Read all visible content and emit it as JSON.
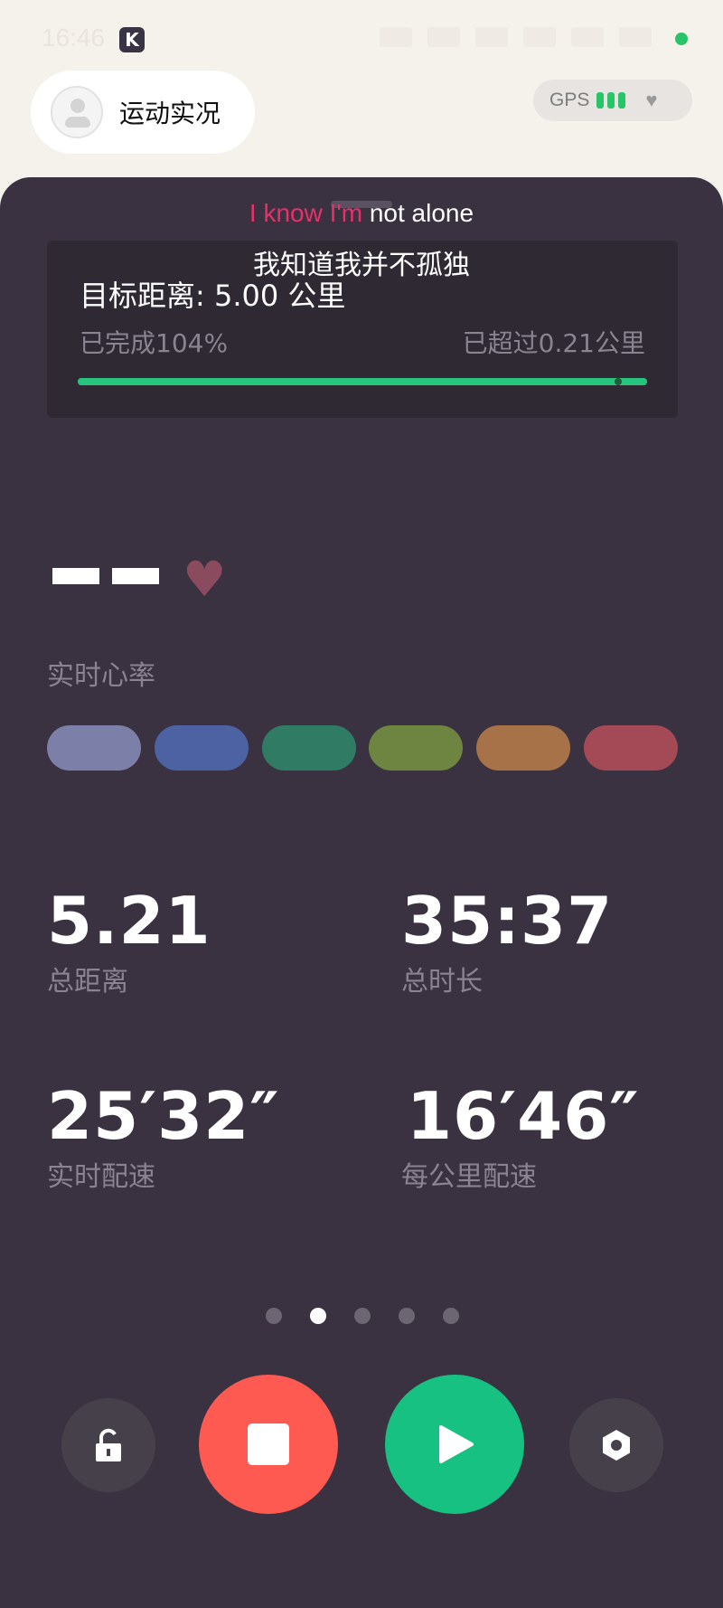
{
  "status_bar": {
    "time": "16:46",
    "app_badge": "K"
  },
  "header": {
    "title": "运动实况",
    "gps_label": "GPS"
  },
  "lyrics": {
    "en_highlight": "I know I'm",
    "en_rest": " not alone",
    "cn": "我知道我并不孤独"
  },
  "goal": {
    "title": "目标距离: 5.00 公里",
    "completed": "已完成104%",
    "exceeded": "已超过0.21公里",
    "progress_fraction": 1.0
  },
  "heart_rate": {
    "label": "实时心率",
    "zone_colors": [
      "#7c7fa7",
      "#4c62a2",
      "#2f7b63",
      "#6d8540",
      "#a87249",
      "#a44a57"
    ]
  },
  "stats": [
    {
      "value": "5.21",
      "label": "总距离"
    },
    {
      "value": "35:37",
      "label": "总时长"
    },
    {
      "value": "25′32″",
      "label": "实时配速"
    },
    {
      "value": "16′46″",
      "label": "每公里配速"
    }
  ],
  "pager": {
    "count": 5,
    "active_index": 1
  },
  "colors": {
    "accent_green": "#16c182",
    "stop_red": "#ff5a52",
    "panel_bg": "#3a3240"
  }
}
